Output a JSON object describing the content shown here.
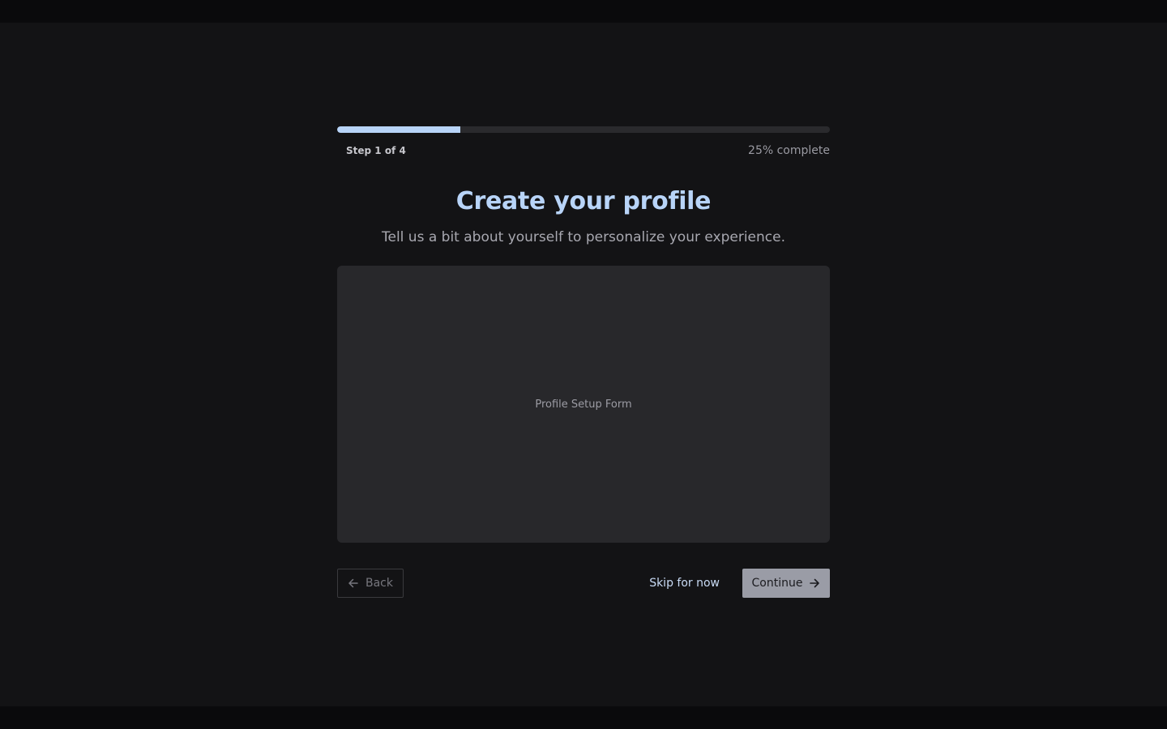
{
  "progress": {
    "fraction": 0.25,
    "step_label": "Step 1 of 4",
    "percent_label": "25% complete"
  },
  "header": {
    "title": "Create your profile",
    "subtitle": "Tell us a bit about yourself to personalize your experience."
  },
  "form": {
    "placeholder": "Profile Setup Form"
  },
  "actions": {
    "back_label": "Back",
    "skip_label": "Skip for now",
    "continue_label": "Continue"
  },
  "icons": {
    "back": "arrow-left-icon",
    "continue": "arrow-right-icon"
  },
  "colors": {
    "accent": "#b8d4f8",
    "background": "#131315",
    "panel": "#28282b"
  }
}
